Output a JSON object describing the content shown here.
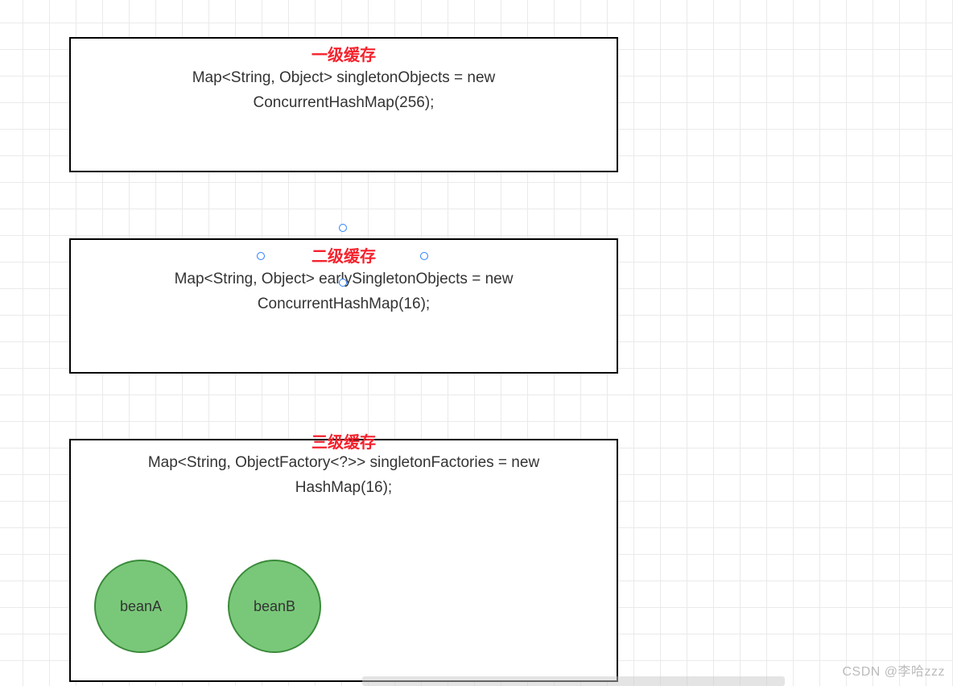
{
  "level1": {
    "title": "一级缓存",
    "line1": "Map<String, Object> singletonObjects = new",
    "line2": "ConcurrentHashMap(256);"
  },
  "level2": {
    "title": "二级缓存",
    "line1": "Map<String, Object> earlySingletonObjects = new",
    "line2": "ConcurrentHashMap(16);"
  },
  "level3": {
    "title": "三级缓存",
    "line1": "Map<String, ObjectFactory<?>> singletonFactories = new",
    "line2": "HashMap(16);"
  },
  "beans": {
    "a": "beanA",
    "b": "beanB"
  },
  "watermark": "CSDN @李哈zzz"
}
